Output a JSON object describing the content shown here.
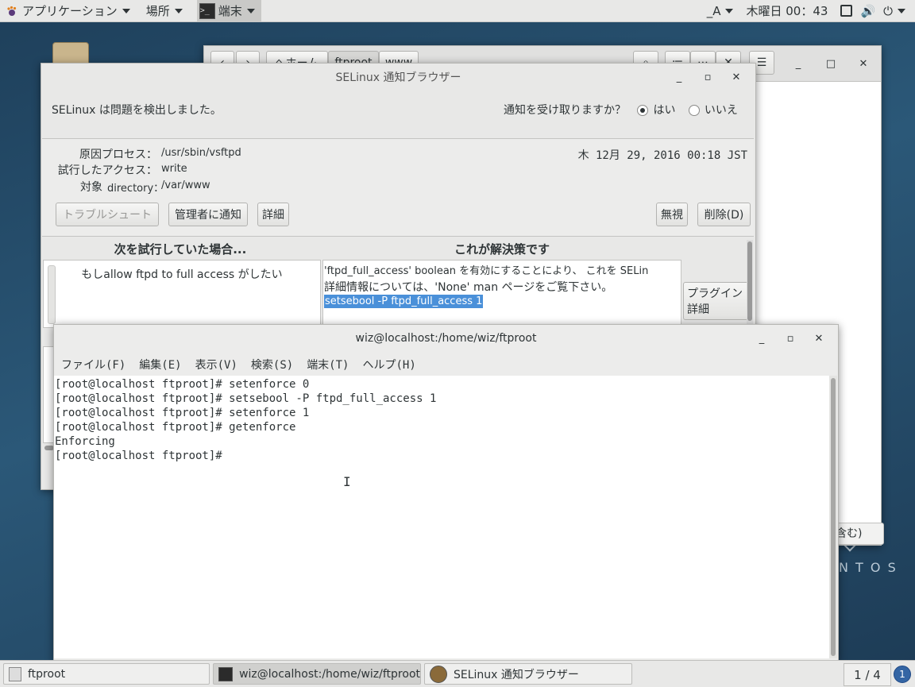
{
  "topbar": {
    "applications": "アプリケーション",
    "places": "場所",
    "active_app": "端末",
    "input_method": "_A",
    "clock": "木曜日 00：43"
  },
  "nautilus": {
    "path_home": "ホーム",
    "path_ftproot": "ftproot",
    "path_www": "www",
    "status_fragment": "含む)"
  },
  "desktop": {
    "centos_text": "N T O S"
  },
  "selinux": {
    "title": "SELinux 通知ブラウザー",
    "detected": "SELinux は問題を検出しました。",
    "notify_question": "通知を受け取りますか？",
    "yes": "はい",
    "no": "いいえ",
    "selected": "yes",
    "labels": {
      "process": "原因プロセス：",
      "access": "試行したアクセス：",
      "target": "対象"
    },
    "values": {
      "process": "/usr/sbin/vsftpd",
      "access": "write",
      "target_class": "directory：",
      "target": "/var/www"
    },
    "date": "木 12月 29, 2016 00:18 JST",
    "buttons": {
      "troubleshoot": "トラブルシュート",
      "notify_admin": "管理者に通知",
      "details": "詳細",
      "ignore": "無視",
      "delete": "削除(D)"
    },
    "col_if": "次を試行していた場合...",
    "col_solution": "これが解決策です",
    "if_text": "もしallow ftpd to full access がしたい",
    "solution_line1": "'ftpd_full_access' boolean を有効にすることにより、 これを SELin",
    "solution_line2": "詳細情報については、'None' man ページをご覧下さい。",
    "solution_cmd": "setsebool -P ftpd_full_access 1",
    "plugin_line1": "プラグイン",
    "plugin_line2": "詳細"
  },
  "terminal": {
    "title": "wiz@localhost:/home/wiz/ftproot",
    "menu": [
      "ファイル(F)",
      "編集(E)",
      "表示(V)",
      "検索(S)",
      "端末(T)",
      "ヘルプ(H)"
    ],
    "lines": [
      "[root@localhost ftproot]# setenforce 0",
      "[root@localhost ftproot]# setsebool -P ftpd_full_access 1",
      "[root@localhost ftproot]# setenforce 1",
      "[root@localhost ftproot]# getenforce",
      "Enforcing",
      "[root@localhost ftproot]# "
    ]
  },
  "taskbar": {
    "tasks": [
      "ftproot",
      "wiz@localhost:/home/wiz/ftproot",
      "SELinux 通知ブラウザー"
    ],
    "workspace": "1 / 4",
    "notifications": "1"
  }
}
